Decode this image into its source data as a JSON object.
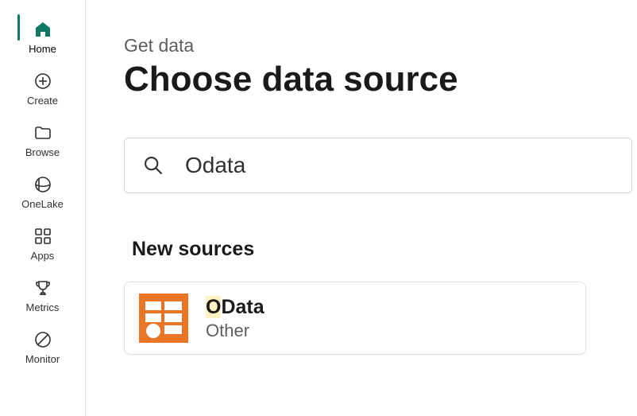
{
  "sidebar": {
    "items": [
      {
        "label": "Home"
      },
      {
        "label": "Create"
      },
      {
        "label": "Browse"
      },
      {
        "label": "OneLake"
      },
      {
        "label": "Apps"
      },
      {
        "label": "Metrics"
      },
      {
        "label": "Monitor"
      }
    ]
  },
  "main": {
    "breadcrumb": "Get data",
    "title": "Choose data source",
    "search": {
      "value": "Odata"
    },
    "section_heading": "New sources",
    "result": {
      "name_prefix": "O",
      "name_rest": "Data",
      "category": "Other"
    }
  }
}
